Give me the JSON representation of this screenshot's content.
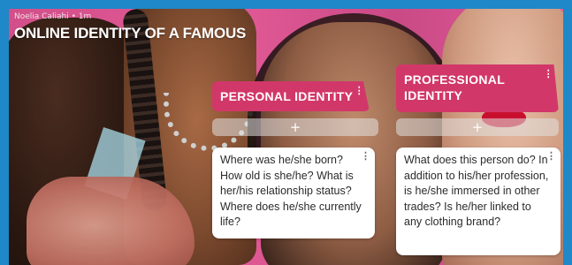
{
  "post": {
    "author": "Noelia Caliahi",
    "time": "1m",
    "title": "ONLINE IDENTITY OF A FAMOUS"
  },
  "columns": [
    {
      "header": "PERSONAL IDENTITY",
      "add_symbol": "+",
      "card_text": "Where was he/she born? How old is she/he? What is her/his relationship status? Where does he/she currently life?"
    },
    {
      "header": "PROFESSIONAL IDENTITY",
      "add_symbol": "+",
      "card_text": "What does this person do? In addition to his/her profession, is he/she immersed in other trades? Is he/her linked to any clothing brand?"
    }
  ],
  "icons": {
    "menu": "kebab-menu-icon",
    "add": "plus-icon"
  },
  "colors": {
    "frame": "#1e88c8",
    "header_bg": "#d2376a",
    "background": "#e25a96"
  }
}
